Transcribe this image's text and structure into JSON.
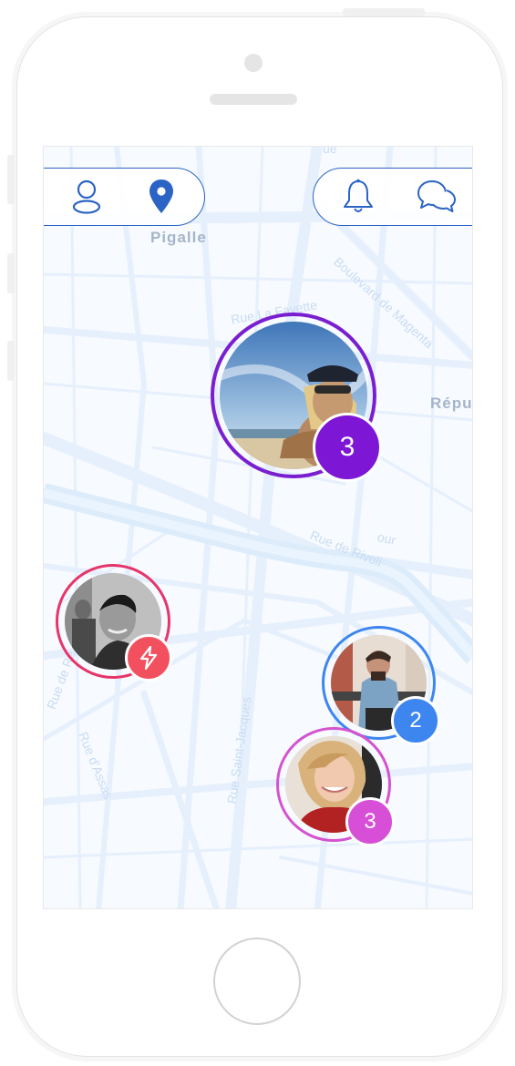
{
  "map": {
    "labels": {
      "pigalle": "Pigalle",
      "republique": "Répu",
      "rue_la_fayette": "Rue La Fayette",
      "boulevard_magenta": "Boulevard de Magenta",
      "rue_de_rivoli": "Rue de Rivoli",
      "rue_saint_jacques": "Rue Saint-Jacques",
      "rue_d_assas": "Rue d'Assas",
      "rue_de_rennes": "Rue de Re",
      "faint_top": "ue",
      "faint_mid": "our"
    }
  },
  "toolbar": {
    "left_icons": [
      "profile-icon",
      "location-pin-icon"
    ],
    "right_icons": [
      "bell-icon",
      "chat-bubbles-icon"
    ],
    "accent_color": "#2b64c4"
  },
  "markers": [
    {
      "id": "surfer",
      "badge": "3",
      "ring_color": "#7a1fd0",
      "badge_color": "#7e16d6"
    },
    {
      "id": "young-man",
      "badge_icon": "lightning-icon",
      "ring_color": "#e6356a",
      "badge_color": "#f2505e"
    },
    {
      "id": "denim-man",
      "badge": "2",
      "ring_color": "#3d86ef",
      "badge_color": "#3d86ef"
    },
    {
      "id": "blonde-woman",
      "badge": "3",
      "ring_color": "#d553d0",
      "badge_color": "#d64fd6"
    }
  ]
}
